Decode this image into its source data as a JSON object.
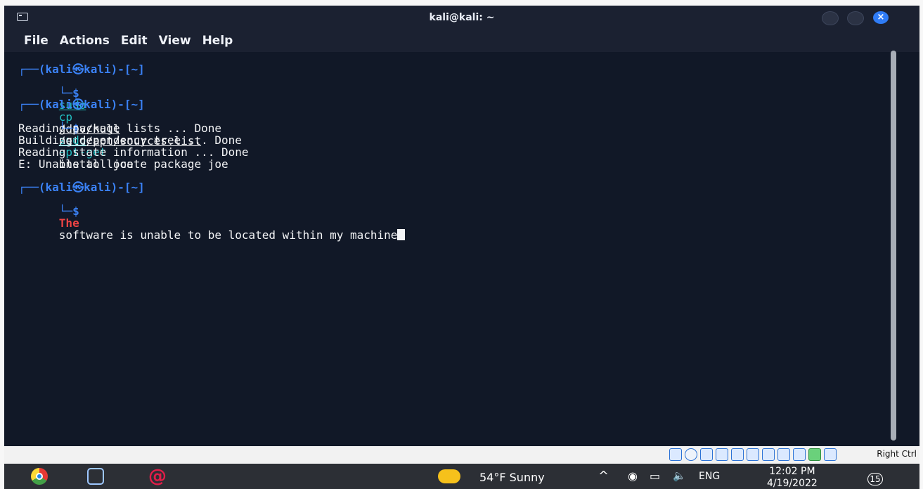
{
  "window": {
    "title": "kali@kali: ~",
    "close_label": "×"
  },
  "menu": {
    "items": [
      "File",
      "Actions",
      "Edit",
      "View",
      "Help"
    ]
  },
  "terminal": {
    "prompt_top": "┌──(kali㉿kali)-[~]",
    "prompt_bottom": "└─$",
    "blocks": [
      {
        "command": {
          "cmd": "sudo",
          "rest_1": "cp",
          "arg1": "/dev/null",
          "arg2": "/etc/apt/sources.list"
        }
      },
      {
        "command": {
          "cmd": "sudo",
          "rest_1": "apt-get",
          "rest_2": "install joe"
        },
        "output": [
          "Reading package lists ... Done",
          "Building dependency tree ... Done",
          "Reading state information ... Done",
          "E: Unable to locate package joe"
        ]
      },
      {
        "command": {
          "cmd": "The",
          "rest": "software is unable to be located within my machine"
        }
      }
    ]
  },
  "vbox_status": {
    "right_ctrl": "Right Ctrl"
  },
  "taskbar": {
    "weather": "54°F  Sunny",
    "language": "ENG",
    "time": "12:02 PM",
    "date": "4/19/2022",
    "notification_count": "15"
  }
}
